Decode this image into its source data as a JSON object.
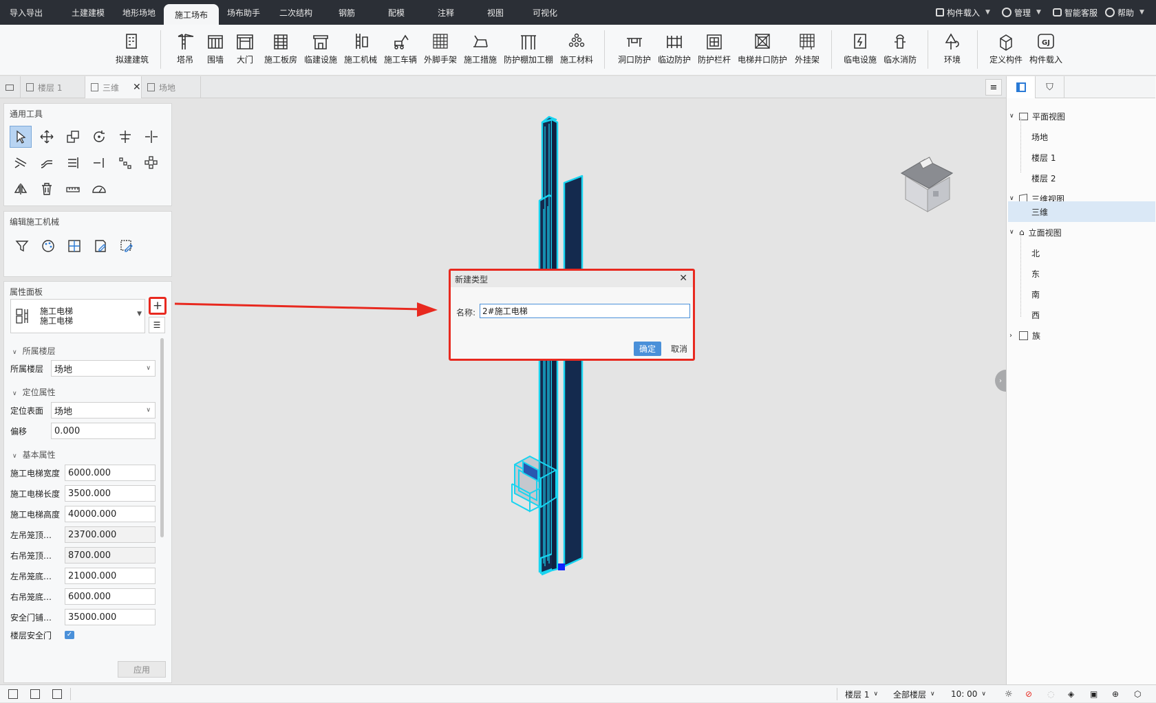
{
  "main_tabs": [
    "导入导出",
    "土建建模",
    "地形场地",
    "施工场布",
    "场布助手",
    "二次结构",
    "钢筋",
    "配模",
    "注释",
    "视图",
    "可视化"
  ],
  "active_tab": "施工场布",
  "top_right": {
    "component_load": "构件载入",
    "manage": "管理",
    "service": "智能客服",
    "help": "帮助"
  },
  "ribbon": [
    "拟建建筑",
    "塔吊",
    "围墙",
    "大门",
    "施工板房",
    "临建设施",
    "施工机械",
    "施工车辆",
    "外脚手架",
    "施工措施",
    "防护棚加工棚",
    "施工材料",
    "洞口防护",
    "临边防护",
    "防护栏杆",
    "电梯井口防护",
    "外挂架",
    "临电设施",
    "临水消防",
    "环境",
    "定义构件",
    "构件载入"
  ],
  "view_tabs": [
    "楼层 1",
    "三维",
    "场地"
  ],
  "general_tools_title": "通用工具",
  "edit_machine_title": "编辑施工机械",
  "props": {
    "title": "属性面板",
    "type_line1": "施工电梯",
    "type_line2": "施工电梯",
    "sec_floor": "所属楼层",
    "floor_label": "所属楼层",
    "floor_value": "场地",
    "sec_position": "定位属性",
    "surface_label": "定位表面",
    "surface_value": "场地",
    "offset_label": "偏移",
    "offset_value": "0.000",
    "sec_basic": "基本属性",
    "rows": [
      {
        "label": "施工电梯宽度",
        "value": "6000.000"
      },
      {
        "label": "施工电梯长度",
        "value": "3500.000"
      },
      {
        "label": "施工电梯高度",
        "value": "40000.000"
      },
      {
        "label": "左吊笼顶…",
        "value": "23700.000"
      },
      {
        "label": "右吊笼顶…",
        "value": "8700.000"
      },
      {
        "label": "左吊笼底…",
        "value": "21000.000"
      },
      {
        "label": "右吊笼底…",
        "value": "6000.000"
      },
      {
        "label": "安全门铺…",
        "value": "35000.000"
      }
    ],
    "safety_gate_label": "楼层安全门",
    "apply": "应用"
  },
  "dialog": {
    "title": "新建类型",
    "name_label": "名称:",
    "name_value": "2#施工电梯",
    "ok": "确定",
    "cancel": "取消"
  },
  "tree": {
    "plan": "平面视图",
    "plan_items": [
      "场地",
      "楼层 1",
      "楼层 2"
    ],
    "view3d": "三维视图",
    "view3d_items": [
      "三维"
    ],
    "elev": "立面视图",
    "elev_items": [
      "北",
      "东",
      "南",
      "西"
    ],
    "family": "族"
  },
  "status": {
    "floor": "楼层 1",
    "all_floors": "全部楼层",
    "time": "10: 00"
  },
  "colors": {
    "accent": "#4a90d9",
    "highlight": "#e8291f",
    "model_fill": "#142a4e",
    "model_edge": "#18d4f0"
  }
}
